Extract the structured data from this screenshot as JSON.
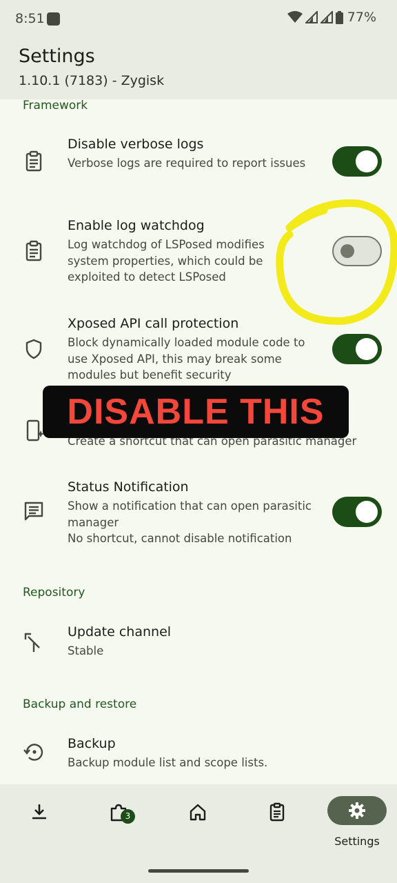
{
  "status_bar": {
    "time": "8:51",
    "battery": "77%"
  },
  "header": {
    "title": "Settings",
    "subtitle": "1.10.1 (7183) - Zygisk"
  },
  "sections": {
    "framework": "Framework",
    "repository": "Repository",
    "backup": "Backup and restore"
  },
  "settings": {
    "verbose": {
      "title": "Disable verbose logs",
      "subtitle": "Verbose logs are required to report issues",
      "icon": "clipboard-icon",
      "enabled": true
    },
    "watchdog": {
      "title": "Enable log watchdog",
      "subtitle": "Log watchdog of LSPosed modifies system properties, which could be exploited to detect LSPosed",
      "icon": "clipboard-icon",
      "enabled": false
    },
    "protection": {
      "title": "Xposed API call protection",
      "subtitle": "Block dynamically loaded module code to use Xposed API, this may break some modules but benefit security",
      "icon": "shield-icon",
      "enabled": true
    },
    "shortcut": {
      "subtitle": "Create a shortcut that can open parasitic manager",
      "icon": "phone-sparkle-icon"
    },
    "notification": {
      "title": "Status Notification",
      "subtitle": "Show a notification that can open parasitic manager",
      "subtitle2": "No shortcut, cannot disable notification",
      "icon": "message-icon",
      "enabled": true
    },
    "update_channel": {
      "title": "Update channel",
      "value": "Stable",
      "icon": "merge-icon"
    },
    "backup": {
      "title": "Backup",
      "subtitle": "Backup module list and scope lists.",
      "icon": "restore-icon"
    }
  },
  "overlay": {
    "banner_text": "DISABLE THIS",
    "banner_color": "#f2473a",
    "circle_color": "#f3ea1c"
  },
  "nav": {
    "items": [
      "download-icon",
      "puzzle-icon",
      "home-icon",
      "logs-icon",
      "settings-icon"
    ],
    "badge_count": "3",
    "active_label": "Settings",
    "accent": "#1d4d16"
  }
}
